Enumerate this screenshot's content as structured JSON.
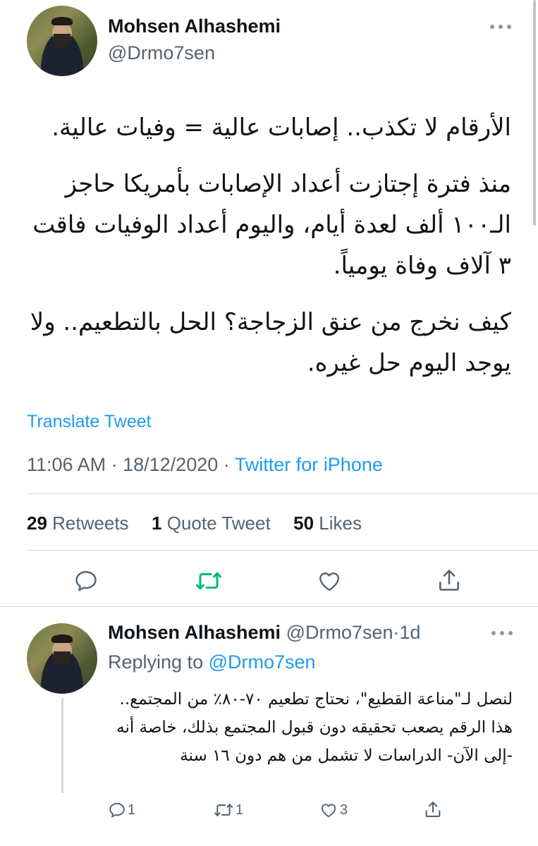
{
  "main_tweet": {
    "author_name": "Mohsen Alhashemi",
    "author_handle": "@Drmo7sen",
    "paragraphs": [
      "الأرقام لا تكذب.. إصابات عالية = وفيات عالية.",
      "منذ فترة إجتازت أعداد الإصابات بأمريكا حاجز الـ١٠٠ ألف لعدة أيام، واليوم أعداد الوفيات فاقت ٣ آلاف وفاة يومياً.",
      "كيف نخرج من عنق الزجاجة؟ الحل بالتطعيم.. ولا يوجد اليوم حل غيره."
    ],
    "translate_label": "Translate Tweet",
    "time": "11:06 AM",
    "date": "18/12/2020",
    "separator": "·",
    "source": "Twitter for iPhone",
    "retweets_count": "29",
    "retweets_label": "Retweets",
    "quotes_count": "1",
    "quotes_label": "Quote Tweet",
    "likes_count": "50",
    "likes_label": "Likes"
  },
  "reply_tweet": {
    "author_name": "Mohsen Alhashemi",
    "author_handle": "@Drmo7sen",
    "separator": "·",
    "age": "1d",
    "replying_label": "Replying to",
    "replying_to": "@Drmo7sen",
    "text": "لنصل لـ\"مناعة القطيع\"، نحتاج تطعيم ٧٠-٨٠٪ من المجتمع.. هذا الرقم يصعب تحقيقه دون قبول المجتمع بذلك، خاصة أنه -إلى الآن- الدراسات لا تشمل من هم دون ١٦ سنة",
    "reply_count": "1",
    "retweet_count": "1",
    "like_count": "3"
  },
  "colors": {
    "text": "#0f1419",
    "secondary": "#536471",
    "accent": "#1d9bf0",
    "retweet_active": "#00ba7c",
    "divider": "#cfd9de"
  },
  "icons": [
    "more-icon",
    "reply-icon",
    "retweet-icon",
    "like-icon",
    "share-icon"
  ]
}
